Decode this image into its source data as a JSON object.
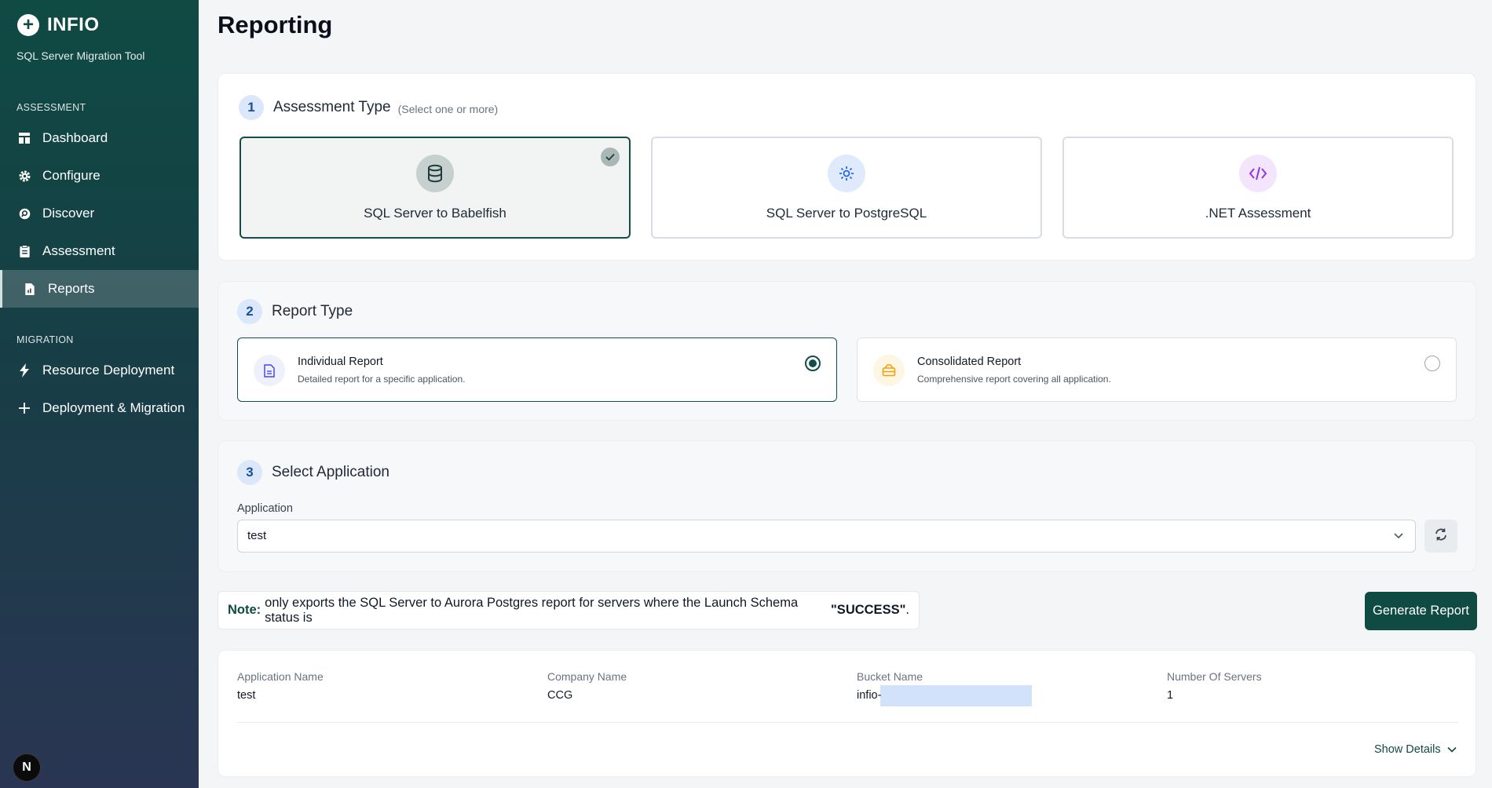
{
  "app": {
    "brand": "INFIO",
    "subtitle": "SQL Server Migration Tool"
  },
  "sidebar": {
    "sections": [
      {
        "label": "ASSESSMENT",
        "items": [
          {
            "label": "Dashboard",
            "icon": "dashboard-icon"
          },
          {
            "label": "Configure",
            "icon": "gear-icon"
          },
          {
            "label": "Discover",
            "icon": "search-icon"
          },
          {
            "label": "Assessment",
            "icon": "clipboard-icon"
          },
          {
            "label": "Reports",
            "icon": "report-icon",
            "active": true
          }
        ]
      },
      {
        "label": "MIGRATION",
        "items": [
          {
            "label": "Resource Deployment",
            "icon": "lightning-icon"
          },
          {
            "label": "Deployment & Migration",
            "icon": "plus-icon"
          }
        ]
      }
    ],
    "badge": "N"
  },
  "page": {
    "title": "Reporting"
  },
  "step1": {
    "num": "1",
    "title": "Assessment Type",
    "hint": "(Select one or more)",
    "options": [
      {
        "label": "SQL Server to Babelfish",
        "icon": "database-icon",
        "selected": true
      },
      {
        "label": "SQL Server to PostgreSQL",
        "icon": "nodes-icon",
        "selected": false
      },
      {
        "label": ".NET Assessment",
        "icon": "code-icon",
        "selected": false
      }
    ]
  },
  "step2": {
    "num": "2",
    "title": "Report Type",
    "options": [
      {
        "title": "Individual Report",
        "desc": "Detailed report for a specific application.",
        "icon": "document-icon",
        "selected": true
      },
      {
        "title": "Consolidated Report",
        "desc": "Comprehensive report covering all application.",
        "icon": "stack-icon",
        "selected": false
      }
    ]
  },
  "step3": {
    "num": "3",
    "title": "Select Application",
    "field_label": "Application",
    "value": "test"
  },
  "note": {
    "lead": "Note:",
    "text": "only exports the SQL Server to Aurora Postgres report for servers where the Launch Schema status is",
    "status": "\"SUCCESS\"",
    "end": "."
  },
  "actions": {
    "generate": "Generate Report",
    "show_details": "Show Details"
  },
  "info": {
    "headers": [
      "Application Name",
      "Company Name",
      "Bucket Name",
      "Number Of Servers"
    ],
    "values": [
      "test",
      "CCG",
      "infio-",
      "1"
    ]
  },
  "colors": {
    "brand": "#0f4a43",
    "step_badge": "#dbe7fb",
    "masked": "#d3e2fb"
  }
}
